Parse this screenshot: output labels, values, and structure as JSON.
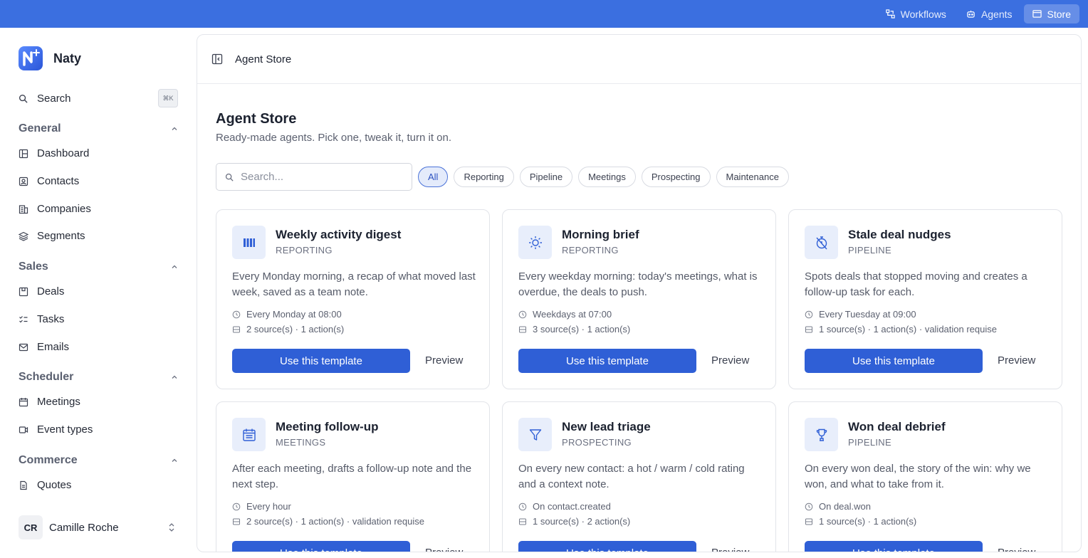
{
  "topnav": [
    {
      "label": "Workflows",
      "icon": "workflow-icon",
      "active": false
    },
    {
      "label": "Agents",
      "icon": "agent-icon",
      "active": false
    },
    {
      "label": "Store",
      "icon": "store-icon",
      "active": true
    }
  ],
  "sidebar": {
    "brand": "Naty",
    "search_label": "Search",
    "search_shortcut": "⌘K",
    "sections": [
      {
        "title": "General",
        "items": [
          "Dashboard",
          "Contacts",
          "Companies",
          "Segments"
        ]
      },
      {
        "title": "Sales",
        "items": [
          "Deals",
          "Tasks",
          "Emails"
        ]
      },
      {
        "title": "Scheduler",
        "items": [
          "Meetings",
          "Event types"
        ]
      },
      {
        "title": "Commerce",
        "items": [
          "Quotes"
        ]
      }
    ],
    "user": {
      "initials": "CR",
      "name": "Camille Roche"
    }
  },
  "main": {
    "header_title": "Agent Store",
    "title": "Agent Store",
    "subtitle": "Ready-made agents. Pick one, tweak it, turn it on.",
    "search_placeholder": "Search...",
    "filters": [
      "All",
      "Reporting",
      "Pipeline",
      "Meetings",
      "Prospecting",
      "Maintenance"
    ],
    "active_filter": "All",
    "use_label": "Use this template",
    "preview_label": "Preview",
    "cards": [
      {
        "name": "Weekly activity digest",
        "category": "REPORTING",
        "icon": "barcode-icon",
        "description": "Every Monday morning, a recap of what moved last week, saved as a team note.",
        "schedule": "Every Monday at 08:00",
        "details": "2 source(s) · 1 action(s)"
      },
      {
        "name": "Morning brief",
        "category": "REPORTING",
        "icon": "sun-icon",
        "description": "Every weekday morning: today's meetings, what is overdue, the deals to push.",
        "schedule": "Weekdays at 07:00",
        "details": "3 source(s) · 1 action(s)"
      },
      {
        "name": "Stale deal nudges",
        "category": "PIPELINE",
        "icon": "timer-off-icon",
        "description": "Spots deals that stopped moving and creates a follow-up task for each.",
        "schedule": "Every Tuesday at 09:00",
        "details": "1 source(s) · 1 action(s) · validation requise"
      },
      {
        "name": "Meeting follow-up",
        "category": "MEETINGS",
        "icon": "calendar-icon",
        "description": "After each meeting, drafts a follow-up note and the next step.",
        "schedule": "Every hour",
        "details": "2 source(s) · 1 action(s) · validation requise"
      },
      {
        "name": "New lead triage",
        "category": "PROSPECTING",
        "icon": "filter-icon",
        "description": "On every new contact: a hot / warm / cold rating and a context note.",
        "schedule": "On contact.created",
        "details": "1 source(s) · 2 action(s)"
      },
      {
        "name": "Won deal debrief",
        "category": "PIPELINE",
        "icon": "trophy-icon",
        "description": "On every won deal, the story of the win: why we won, and what to take from it.",
        "schedule": "On deal.won",
        "details": "1 source(s) · 1 action(s)"
      }
    ]
  },
  "colors": {
    "topbar": "#3b6fe0",
    "primary": "#2f5fd6",
    "icon_bg": "#e8eefb",
    "chip_active_bg": "#e4ebfb"
  }
}
